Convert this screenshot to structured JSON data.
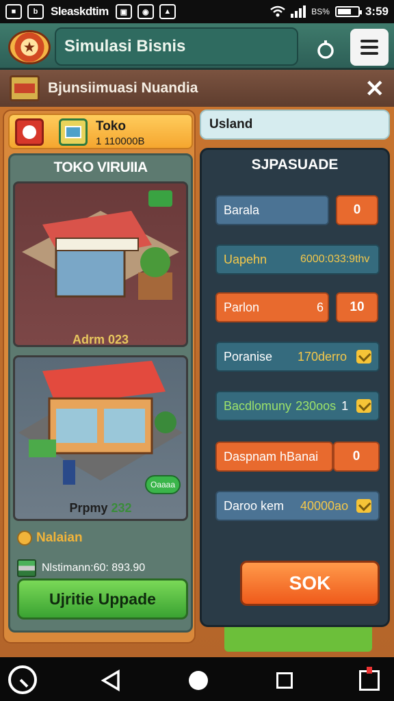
{
  "status_bar": {
    "app_label": "Sleaskdtim",
    "battery_text": "BS%",
    "time": "3:59"
  },
  "app_header": {
    "title": "Simulasi Bisnis"
  },
  "sub_header": {
    "title": "Bjunsiimuasi Nuandia"
  },
  "left": {
    "toko": {
      "name": "Toko",
      "value": "1 110000B"
    },
    "panel_title": "TOKO VIRUIIA",
    "shops": [
      {
        "label": "Adrm 023"
      },
      {
        "label_prefix": "Prpmy",
        "label_num": "232",
        "badge": "Oaaaa"
      }
    ],
    "section_label": "Nalaian",
    "stat_line": "Nlstimann:60: 893.90",
    "upgrade_label": "Ujritie Uppade"
  },
  "right": {
    "top_card": "Usland",
    "panel_title": "SJPASUADE",
    "rows": [
      {
        "label": "Barala",
        "value": "0"
      },
      {
        "label": "Uapehn",
        "value": "6000:033:9thv"
      },
      {
        "label": "Parlon",
        "mid": "6",
        "value": "10"
      },
      {
        "label": "Poranise",
        "value": "170derro"
      },
      {
        "label": "Bacdlomuny",
        "value": "230oos",
        "extra": "1"
      },
      {
        "label": "Daspnam hBanai",
        "value": "0"
      },
      {
        "label": "Daroo kem",
        "value": "40000ao"
      }
    ],
    "action_label": "SOK"
  },
  "colors": {
    "accent_orange": "#e86a2e",
    "accent_green": "#3aa332",
    "panel_dark": "#2a3b47",
    "header_teal": "#2f6b60"
  }
}
